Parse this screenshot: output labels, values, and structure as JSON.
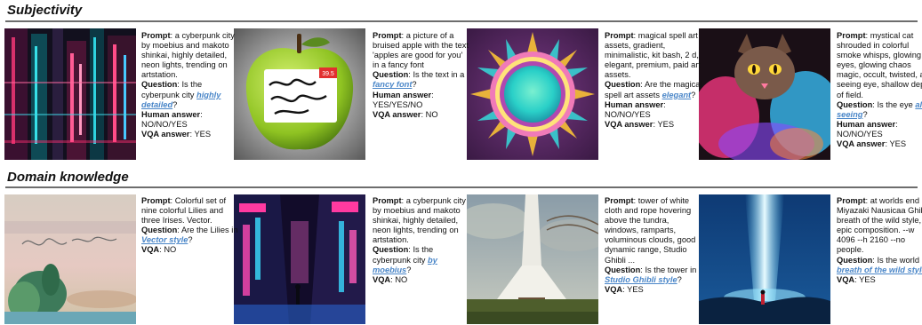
{
  "sections": {
    "subjectivity": "Subjectivity",
    "domain": "Domain knowledge"
  },
  "labels": {
    "prompt": "Prompt",
    "question": "Question",
    "human": "Human answer",
    "vqa_full": "VQA answer",
    "vqa": "VQA"
  },
  "examples": [
    {
      "prompt": "a cyberpunk city by moebius and makoto shinkai, highly detailed, neon lights, trending on artstation.",
      "q_pre": "Is the cyberpunk city ",
      "q_hl": "highly detailed",
      "q_post": "?",
      "human": "NO/NO/YES",
      "vqa": "YES"
    },
    {
      "prompt": "a picture of a bruised apple with the text 'apples are good for you' in a fancy font",
      "q_pre": "Is the text in a ",
      "q_hl": "fancy font",
      "q_post": "?",
      "human": "YES/YES/NO",
      "vqa": "NO",
      "sticker": "39.5"
    },
    {
      "prompt": "magical spell art assets, gradient, minimalistic, kit bash, 2 d, elegant, premium, paid art assets.",
      "q_pre": "Are the magical spell art assets ",
      "q_hl": "elegant",
      "q_post": "?",
      "human": "NO/NO/YES",
      "vqa": "YES"
    },
    {
      "prompt": "mystical cat shrouded in colorful smoke whisps, glowing eyes, glowing chaos magic, occult, twisted, all seeing eye, shallow depth of field.",
      "q_pre": "Is the eye ",
      "q_hl": "all seeing",
      "q_post": "?",
      "human": "NO/NO/YES",
      "vqa": "YES"
    },
    {
      "prompt": "Colorful set of nine colorful Lilies and three Irises. Vector.",
      "q_pre": "Are the Lilies in ",
      "q_hl": "Vector style",
      "q_post": "?",
      "vqa": "NO"
    },
    {
      "prompt": "a cyberpunk city by moebius and makoto shinkai, highly detailed, neon lights, trending on artstation.",
      "q_pre": "Is the cyberpunk city ",
      "q_hl": "by moebius",
      "q_post": "?",
      "vqa": "NO"
    },
    {
      "prompt": "tower of white cloth and rope hovering above the tundra, windows, ramparts, voluminous clouds, good dynamic range, Studio Ghibli ...",
      "q_pre": "Is the tower in ",
      "q_hl": "Studio Ghibli style",
      "q_post": "?",
      "vqa": "YES"
    },
    {
      "prompt": "at worlds end by Miyazaki Nausicaa Ghibli, breath of the wild style, epic composition.  --w 4096 --h 2160 --no people.",
      "q_pre": "Is the world ",
      "q_hl": "breath of the wild style",
      "q_post": "?",
      "vqa": "YES"
    }
  ]
}
